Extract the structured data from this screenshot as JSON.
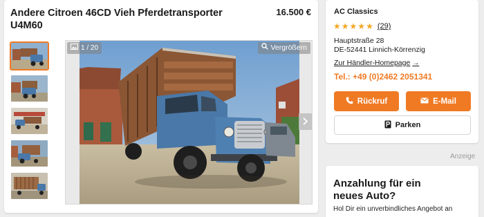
{
  "listing": {
    "title": "Andere Citroen 46CD Vieh Pferdetransporter U4M60",
    "price": "16.500 €"
  },
  "gallery": {
    "counter": "1 / 20",
    "zoom_label": "Vergrößern",
    "thumbnail_count": 5
  },
  "dealer": {
    "name": "AC Classics",
    "rating_stars": 5,
    "rating_count": "(29)",
    "street": "Hauptstraße 28",
    "city": "DE-52441 Linnich-Körrenzig",
    "homepage_label": "Zur Händler-Homepage",
    "phone": "Tel.: +49 (0)2462 2051341",
    "call_label": "Rückruf",
    "email_label": "E-Mail",
    "park_label": "Parken"
  },
  "ad": {
    "label": "Anzeige",
    "title": "Anzahlung für ein neues Auto?",
    "text": "Hol Dir ein unverbindliches Angebot an"
  },
  "colors": {
    "accent": "#f07a24",
    "star": "#f5a623",
    "truck_blue": "#4a78a8"
  }
}
